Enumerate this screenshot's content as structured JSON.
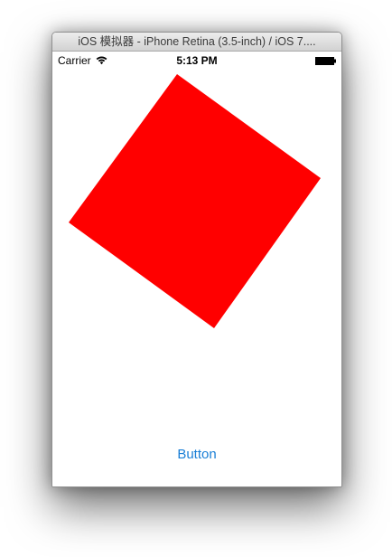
{
  "window": {
    "title": "iOS 模拟器 - iPhone Retina (3.5-inch) / iOS 7...."
  },
  "statusbar": {
    "carrier": "Carrier",
    "time": "5:13 PM",
    "wifi_icon": "wifi-icon",
    "battery_icon": "battery-icon"
  },
  "content": {
    "square_color": "#ff0000",
    "square_rotation_degrees": 37
  },
  "button": {
    "label": "Button",
    "color": "#1a7fd6"
  }
}
